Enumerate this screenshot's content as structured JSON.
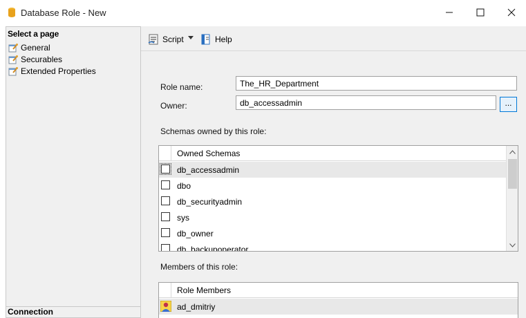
{
  "window": {
    "title": "Database Role - New",
    "minimize_glyph": "—",
    "maximize_glyph": "☐",
    "close_glyph": "✕",
    "icon": "database-icon"
  },
  "left_pane": {
    "header": "Select a page",
    "items": [
      {
        "label": "General",
        "icon": "page-wrench-icon"
      },
      {
        "label": "Securables",
        "icon": "page-wrench-icon"
      },
      {
        "label": "Extended Properties",
        "icon": "page-wrench-icon"
      }
    ],
    "connection_header": "Connection"
  },
  "toolbar": {
    "script_label": "Script",
    "help_label": "Help"
  },
  "form": {
    "role_name_label": "Role name:",
    "role_name_value": "The_HR_Department",
    "owner_label": "Owner:",
    "owner_value": "db_accessadmin",
    "browse_label": "...",
    "schemas_label": "Schemas owned by this role:",
    "members_label": "Members of this role:"
  },
  "schemas_grid": {
    "column_header": "Owned Schemas",
    "rows": [
      {
        "name": "db_accessadmin",
        "checked": false,
        "selected": true
      },
      {
        "name": "dbo",
        "checked": false,
        "selected": false
      },
      {
        "name": "db_securityadmin",
        "checked": false,
        "selected": false
      },
      {
        "name": "sys",
        "checked": false,
        "selected": false
      },
      {
        "name": "db_owner",
        "checked": false,
        "selected": false
      },
      {
        "name": "db_backupoperator",
        "checked": false,
        "selected": false
      }
    ]
  },
  "members_grid": {
    "column_header": "Role Members",
    "rows": [
      {
        "name": "ad_dmitriy",
        "icon": "user-icon",
        "selected": true
      }
    ]
  },
  "colors": {
    "accent": "#0078d7",
    "pane_bg": "#f0f0f0",
    "selected_row": "#e8e8e8"
  }
}
